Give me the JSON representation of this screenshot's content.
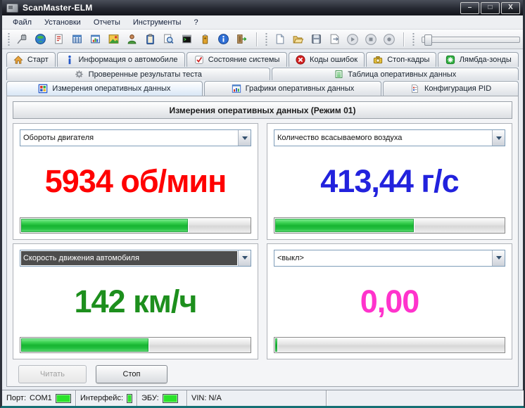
{
  "window": {
    "title": "ScanMaster-ELM",
    "controls": {
      "minimize": "–",
      "maximize": "□",
      "close": "X"
    }
  },
  "menu": {
    "items": [
      "Файл",
      "Установки",
      "Отчеты",
      "Инструменты",
      "?"
    ]
  },
  "toolbar": {
    "icons": [
      "connect",
      "globe",
      "report",
      "data-table",
      "data-chart",
      "gallery",
      "user",
      "clipboard",
      "search",
      "console",
      "battery",
      "info",
      "exit",
      "new-file",
      "open",
      "save",
      "export",
      "play",
      "stop",
      "record"
    ],
    "slider_present": true
  },
  "tabs": {
    "row1": [
      {
        "label": "Старт",
        "icon": "home"
      },
      {
        "label": "Информация о автомобиле",
        "icon": "info-i"
      },
      {
        "label": "Состояние системы",
        "icon": "checkbox-red-check"
      },
      {
        "label": "Коды ошибок",
        "icon": "red-x-circle"
      },
      {
        "label": "Стоп-кадры",
        "icon": "camera"
      },
      {
        "label": "Лямбда-зонды",
        "icon": "green-asterisk"
      }
    ],
    "row2": [
      {
        "label": "Проверенные результаты теста",
        "icon": "gear"
      },
      {
        "label": "Таблица оперативных данных",
        "icon": "green-table"
      }
    ],
    "row3": [
      {
        "label": "Измерения оперативных данных",
        "icon": "color-grid",
        "active": true
      },
      {
        "label": "Графики оперативных данных",
        "icon": "bar-chart"
      },
      {
        "label": "Конфигурация PID",
        "icon": "pid-doc"
      }
    ]
  },
  "main": {
    "header": "Измерения оперативных данных (Режим 01)",
    "panels": [
      {
        "param": "Обороты двигателя",
        "value": "5934 об/мин",
        "value_style": "color:#ff0000",
        "fill_percent": 73
      },
      {
        "param": "Количество всасываемого воздуха",
        "value": "413,44 г/с",
        "value_style": "color:#2222dd",
        "fill_percent": 61
      },
      {
        "param": "Скорость движения автомобиля",
        "value": "142 км/ч",
        "value_style": "color:#1d8f1d",
        "fill_percent": 56,
        "selected": true
      },
      {
        "param": "<выкл>",
        "value": "0,00",
        "value_style": "color:#ff33cc",
        "fill_percent": 1.5
      }
    ],
    "read_button": "Читать",
    "stop_button": "Стоп"
  },
  "statusbar": {
    "port_label": "Порт:",
    "port_value": "COM1",
    "interface_label": "Интерфейс:",
    "ecu_label": "ЭБУ:",
    "vin": "VIN: N/A",
    "led_style": "background:#2be32b"
  },
  "colors": {
    "value_red": "#ff0000",
    "value_blue": "#2222dd",
    "value_green": "#1d8f1d",
    "value_magenta": "#ff33cc",
    "progress_green": "#2ecc43",
    "led_green": "#2be32b",
    "titlebar_dark": "#1a1d24"
  }
}
